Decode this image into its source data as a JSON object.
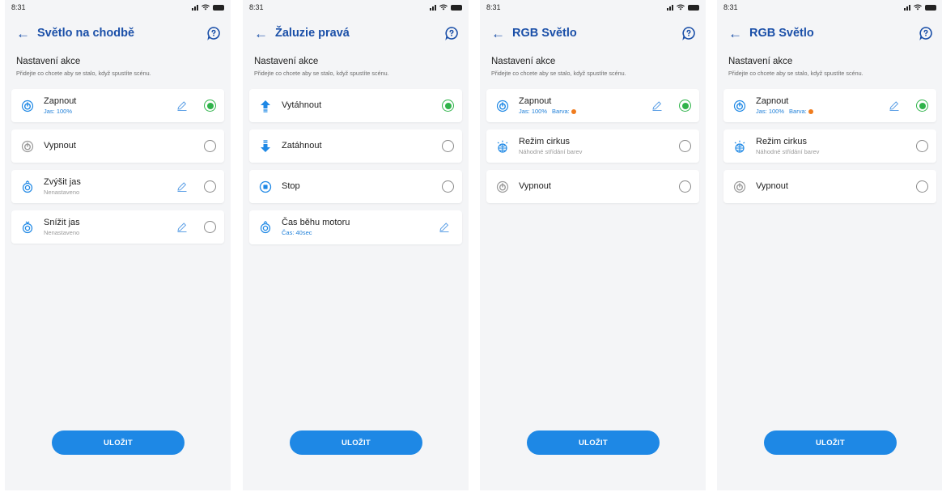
{
  "status_time": "8:31",
  "section_title": "Nastavení akce",
  "section_subtitle": "Přidejte co chcete aby se stalo, když spustíte scénu.",
  "save_label": "ULOŽIT",
  "colors": {
    "accent": "#1e88e5",
    "title": "#1a4fa8",
    "selected": "#2fb34a",
    "orange_dot": "#f07c1e"
  },
  "screens": [
    {
      "title": "Světlo na chodbě",
      "items": [
        {
          "label": "Zapnout",
          "sub": "Jas: 100%",
          "icon": "power-icon",
          "editable": true,
          "selected": true
        },
        {
          "label": "Vypnout",
          "sub": "",
          "icon": "power-off-icon",
          "editable": false,
          "selected": false
        },
        {
          "label": "Zvýšit jas",
          "sub": "Nenastaveno",
          "icon": "brightness-up-icon",
          "editable": true,
          "selected": false
        },
        {
          "label": "Snížit jas",
          "sub": "Nenastaveno",
          "icon": "brightness-down-icon",
          "editable": true,
          "selected": false
        }
      ]
    },
    {
      "title": "Žaluzie pravá",
      "items": [
        {
          "label": "Vytáhnout",
          "sub": "",
          "icon": "arrow-up-icon",
          "editable": false,
          "selected": true
        },
        {
          "label": "Zatáhnout",
          "sub": "",
          "icon": "arrow-down-icon",
          "editable": false,
          "selected": false
        },
        {
          "label": "Stop",
          "sub": "",
          "icon": "stop-icon",
          "editable": false,
          "selected": false
        },
        {
          "label": "Čas běhu motoru",
          "sub": "Čas: 40sec",
          "icon": "timer-icon",
          "editable": true,
          "selected": null
        }
      ]
    },
    {
      "title": "RGB Světlo",
      "items": [
        {
          "label": "Zapnout",
          "sub": "Jas: 100%",
          "barva": "Barva:",
          "icon": "power-icon",
          "editable": true,
          "selected": true
        },
        {
          "label": "Režim cirkus",
          "sub": "Náhodné střídání barev",
          "icon": "circus-icon",
          "editable": false,
          "selected": false
        },
        {
          "label": "Vypnout",
          "sub": "",
          "icon": "power-off-icon",
          "editable": false,
          "selected": false
        }
      ]
    },
    {
      "title": "RGB Světlo",
      "items": [
        {
          "label": "Zapnout",
          "sub": "Jas: 100%",
          "barva": "Barva:",
          "icon": "power-icon",
          "editable": true,
          "selected": true
        },
        {
          "label": "Režim cirkus",
          "sub": "Náhodné střídání barev",
          "icon": "circus-icon",
          "editable": false,
          "selected": false
        },
        {
          "label": "Vypnout",
          "sub": "",
          "icon": "power-off-icon",
          "editable": false,
          "selected": false
        }
      ]
    }
  ]
}
